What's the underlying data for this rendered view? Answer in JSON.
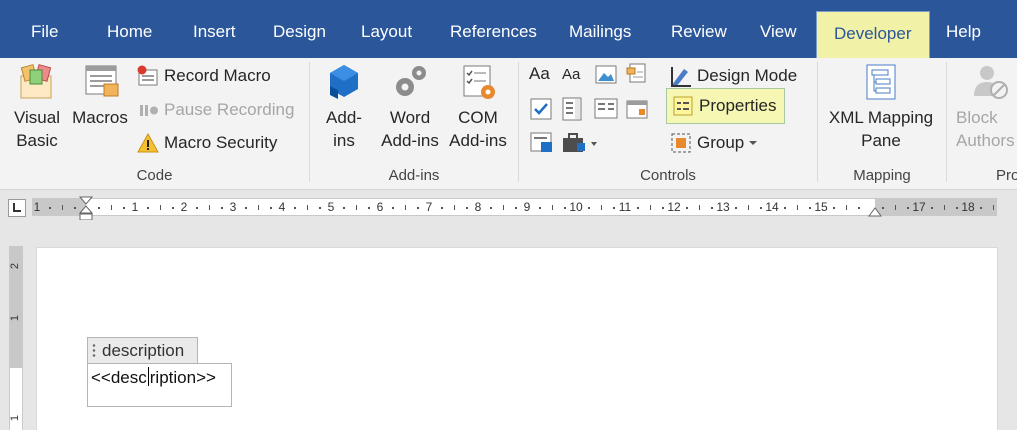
{
  "tabs": [
    {
      "label": "File"
    },
    {
      "label": "Home"
    },
    {
      "label": "Insert"
    },
    {
      "label": "Design"
    },
    {
      "label": "Layout"
    },
    {
      "label": "References"
    },
    {
      "label": "Mailings"
    },
    {
      "label": "Review"
    },
    {
      "label": "View"
    },
    {
      "label": "Developer"
    },
    {
      "label": "Help"
    }
  ],
  "active_tab": "Developer",
  "ribbon": {
    "code": {
      "label": "Code",
      "visual_basic": "Visual\nBasic",
      "macros": "Macros",
      "record_macro": "Record Macro",
      "pause_recording": "Pause Recording",
      "macro_security": "Macro Security"
    },
    "addins": {
      "label": "Add-ins",
      "addins": "Add-\nins",
      "word_addins": "Word\nAdd-ins",
      "com_addins": "COM\nAdd-ins"
    },
    "controls": {
      "label": "Controls",
      "design_mode": "Design Mode",
      "properties": "Properties",
      "group": "Group",
      "rich_text_glyph": "Aa",
      "plain_text_glyph": "Aa"
    },
    "mapping": {
      "label": "Mapping",
      "xml_mapping_pane": "XML Mapping\nPane"
    },
    "protect": {
      "label": "Pro",
      "block_authors": "Block\nAuthors"
    }
  },
  "ruler": {
    "numbers": [
      "1",
      "1",
      "2",
      "3",
      "4",
      "5",
      "6",
      "7",
      "8",
      "9",
      "10",
      "11",
      "12",
      "13",
      "14",
      "15",
      "17",
      "18"
    ],
    "vertical_numbers": [
      "2",
      "1",
      "1"
    ]
  },
  "document": {
    "content_control_tag": "description",
    "content_before_caret": "<<desc",
    "content_after_caret": "ription>>"
  },
  "colors": {
    "tab_bar": "#2b579a",
    "active_tab_highlight": "#f1f1a8",
    "properties_highlight": "#f7f7b4"
  }
}
